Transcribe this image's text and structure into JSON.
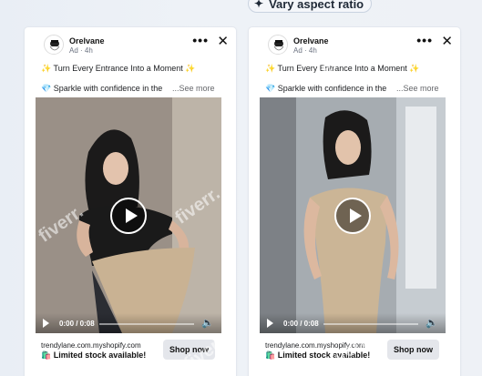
{
  "banner": {
    "label": "Vary aspect ratio",
    "icon": "sparkle-icon"
  },
  "cards": [
    {
      "brand": "Orelvane",
      "ad_tag": "Ad · 4h",
      "line1": "✨ Turn Every Entrance Into a Moment ✨",
      "line2": "💎 Sparkle with confidence in the",
      "see_more": "...See more",
      "time": "0:00 / 0:08",
      "domain": "trendylane.com.myshopify.com",
      "stock": "🛍️ Limited stock available!",
      "cta": "Shop now"
    },
    {
      "brand": "Orelvane",
      "ad_tag": "Ad · 4h",
      "line1": "✨ Turn Every Entrance Into a Moment ✨",
      "line2": "💎 Sparkle with confidence in the",
      "see_more": "...See more",
      "time": "0:00 / 0:08",
      "domain": "trendylane.com.myshopify.com",
      "stock": "🛍️ Limited stock available!",
      "cta": "Shop now"
    }
  ],
  "watermark": "fiverr."
}
